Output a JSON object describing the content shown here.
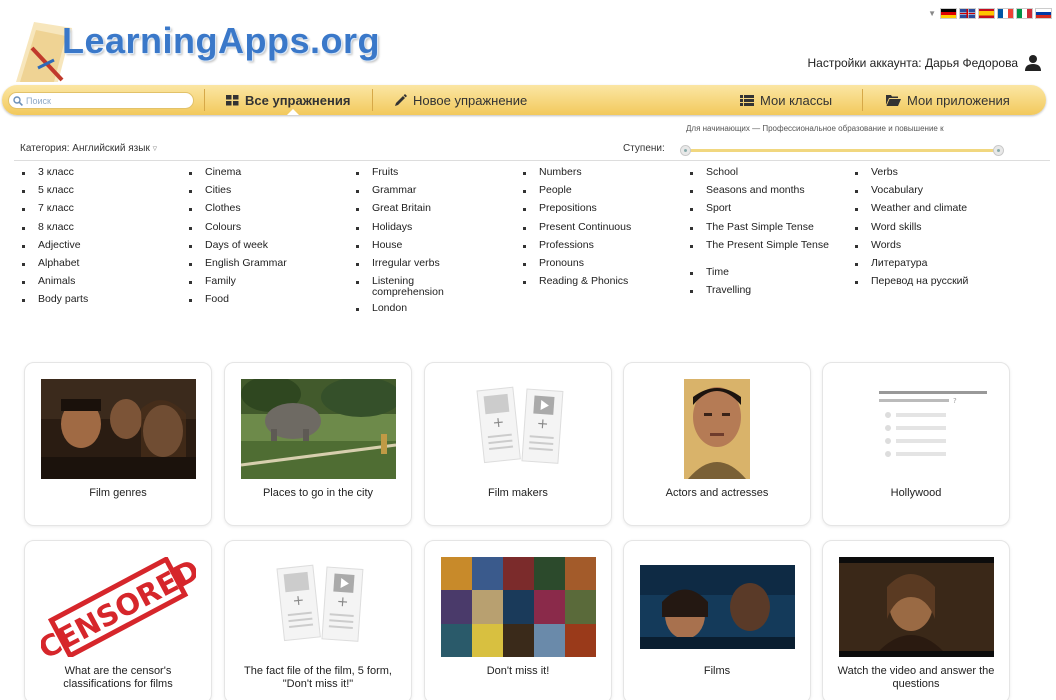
{
  "header": {
    "logo": "LearningApps.org",
    "account_label": "Настройки аккаунта: Дарья Федорова"
  },
  "navbar": {
    "search_placeholder": "Поиск",
    "all_exercises": "Все упражнения",
    "new_exercise": "Новое упражнение",
    "my_classes": "Мои классы",
    "my_apps": "Мои приложения"
  },
  "filter": {
    "category_label": "Категория: Английский язык",
    "steps_label": "Ступени:",
    "levels_range": "Для начинающих — Профессиональное образование и повышение к"
  },
  "columns": [
    [
      "3 класс",
      "5 класс",
      "7 класс",
      "8 класс",
      "Adjective",
      "Alphabet",
      "Animals",
      "Body parts"
    ],
    [
      "Cinema",
      "Cities",
      "Clothes",
      "Colours",
      "Days of week",
      "English Grammar",
      "Family",
      "Food"
    ],
    [
      "Fruits",
      "Grammar",
      "Great Britain",
      "Holidays",
      "House",
      "Irregular verbs",
      "Listening comprehension",
      "London"
    ],
    [
      "Numbers",
      "People",
      "Prepositions",
      "Present Continuous",
      "Professions",
      "Pronouns",
      "Reading & Phonics"
    ],
    [
      "School",
      "Seasons and months",
      "Sport",
      "The Past Simple Tense",
      "The Present Simple Tense",
      "Time",
      "Travelling"
    ],
    [
      "Verbs",
      "Vocabulary",
      "Weather and climate",
      "Word skills",
      "Words",
      "Литература",
      "Перевод на русский"
    ]
  ],
  "cards": [
    {
      "title": "Film genres"
    },
    {
      "title": "Places to go in the city"
    },
    {
      "title": "Film makers"
    },
    {
      "title": "Actors and actresses"
    },
    {
      "title": "Hollywood"
    },
    {
      "title": "What are the censor's classifications for films"
    },
    {
      "title": "The fact file of the film, 5 form, \"Don't miss it!\""
    },
    {
      "title": "Don't miss it!"
    },
    {
      "title": "Films"
    },
    {
      "title": "Watch the video and answer the questions"
    }
  ],
  "censored_stamp": "CENSORED",
  "colors": {
    "logo_blue": "#3a78c9",
    "nav_yellow": "#f2c95c",
    "slider_track": "#f1d77f"
  }
}
